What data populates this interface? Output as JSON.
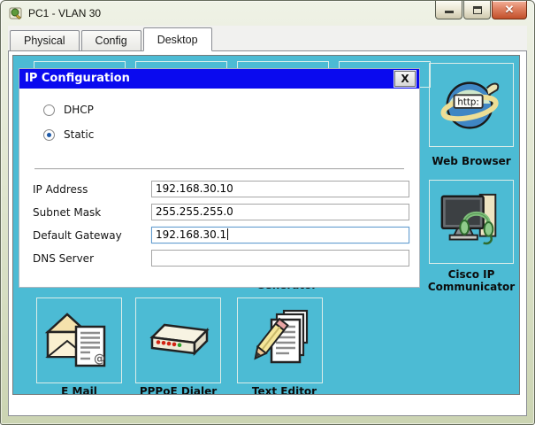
{
  "window": {
    "title": "PC1 - VLAN 30"
  },
  "tabs": [
    {
      "label": "Physical",
      "active": false
    },
    {
      "label": "Config",
      "active": false
    },
    {
      "label": "Desktop",
      "active": true
    }
  ],
  "dialog": {
    "title": "IP Configuration",
    "radios": [
      {
        "label": "DHCP",
        "selected": false
      },
      {
        "label": "Static",
        "selected": true
      }
    ],
    "fields": [
      {
        "label": "IP Address",
        "value": "192.168.30.10",
        "focused": false
      },
      {
        "label": "Subnet Mask",
        "value": "255.255.255.0",
        "focused": false
      },
      {
        "label": "Default Gateway",
        "value": "192.168.30.1",
        "focused": true
      },
      {
        "label": "DNS Server",
        "value": "",
        "focused": false
      }
    ]
  },
  "desktop": {
    "partial_label": "Generator",
    "right_icons": [
      {
        "label": "Web Browser",
        "icon": "web-browser-icon"
      },
      {
        "label": "Cisco IP Communicator",
        "icon": "cisco-ip-communicator-icon"
      }
    ],
    "bottom_icons": [
      {
        "label": "E Mail",
        "icon": "email-icon"
      },
      {
        "label": "PPPoE Dialer",
        "icon": "pppoe-dialer-icon"
      },
      {
        "label": "Text Editor",
        "icon": "text-editor-icon"
      }
    ]
  },
  "icons": {
    "window_close": "✕",
    "dialog_close": "X",
    "web_browser_http": "http:",
    "email_at": "@"
  },
  "colors": {
    "desktop_background": "#4CBBD4",
    "dialog_titlebar_blue": "#0A0AEF",
    "window_frame_green": "#DFE5CE",
    "close_button_red": "#DE8061"
  }
}
